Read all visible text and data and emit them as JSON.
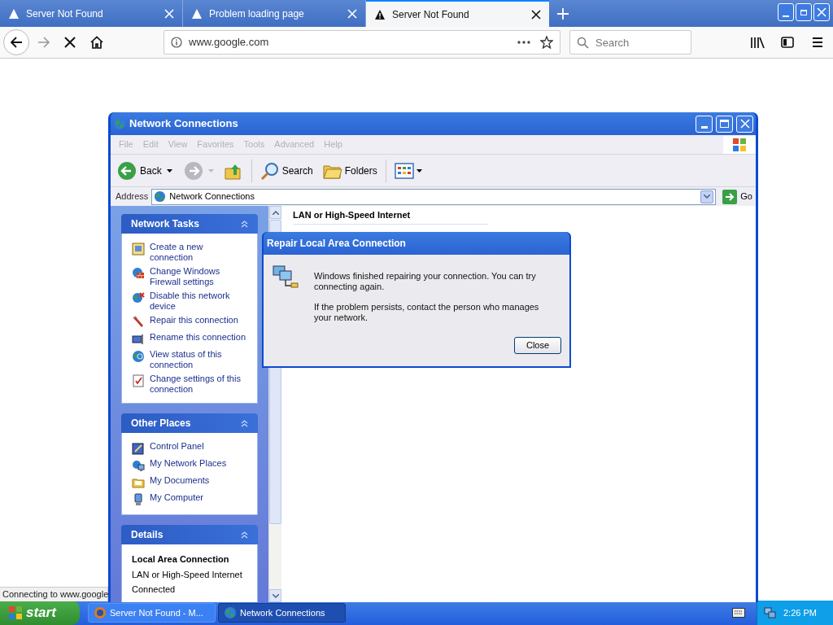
{
  "browser": {
    "tabs": [
      {
        "title": "Server Not Found",
        "selected": false
      },
      {
        "title": "Problem loading page",
        "selected": false
      },
      {
        "title": "Server Not Found",
        "selected": true
      }
    ],
    "url": "www.google.com",
    "search": {
      "placeholder": "Search"
    },
    "status_text": "Connecting to www.google"
  },
  "xp_window": {
    "title": "Network Connections",
    "menu": [
      {
        "label": "File",
        "disabled": true
      },
      {
        "label": "Edit",
        "disabled": true
      },
      {
        "label": "View",
        "disabled": true
      },
      {
        "label": "Favorites",
        "disabled": true
      },
      {
        "label": "Tools",
        "disabled": true
      },
      {
        "label": "Advanced",
        "disabled": true
      },
      {
        "label": "Help",
        "disabled": true
      }
    ],
    "toolbar": {
      "back": "Back",
      "search": "Search",
      "folders": "Folders"
    },
    "address": {
      "label": "Address",
      "value": "Network Connections",
      "go": "Go"
    },
    "panels": [
      {
        "title": "Network Tasks",
        "items": [
          {
            "label": "Create a new connection",
            "kind": "new"
          },
          {
            "label": "Change Windows Firewall settings",
            "kind": "firewall"
          },
          {
            "label": "Disable this network device",
            "kind": "disable"
          },
          {
            "label": "Repair this connection",
            "kind": "repair"
          },
          {
            "label": "Rename this connection",
            "kind": "rename"
          },
          {
            "label": "View status of this connection",
            "kind": "status"
          },
          {
            "label": "Change settings of this connection",
            "kind": "settings"
          }
        ]
      },
      {
        "title": "Other Places",
        "items": [
          {
            "label": "Control Panel",
            "kind": "control"
          },
          {
            "label": "My Network Places",
            "kind": "network"
          },
          {
            "label": "My Documents",
            "kind": "documents"
          },
          {
            "label": "My Computer",
            "kind": "computer"
          }
        ]
      }
    ],
    "details": {
      "title": "Details",
      "name": "Local Area Connection",
      "type": "LAN or High-Speed Internet",
      "status": "Connected"
    },
    "group_heading": "LAN or High-Speed Internet"
  },
  "dialog": {
    "title": "Repair Local Area Connection",
    "paragraphs": [
      "Windows finished repairing your connection. You can try connecting again.",
      "If the problem persists, contact the person who manages your network."
    ],
    "button": "Close"
  },
  "taskbar": {
    "start": "start",
    "tasks": [
      {
        "label": "Server Not Found - M...",
        "selected": false,
        "kind": "browser"
      },
      {
        "label": "Network Connections",
        "selected": true,
        "kind": "network"
      }
    ],
    "clock": "2:26 PM"
  }
}
